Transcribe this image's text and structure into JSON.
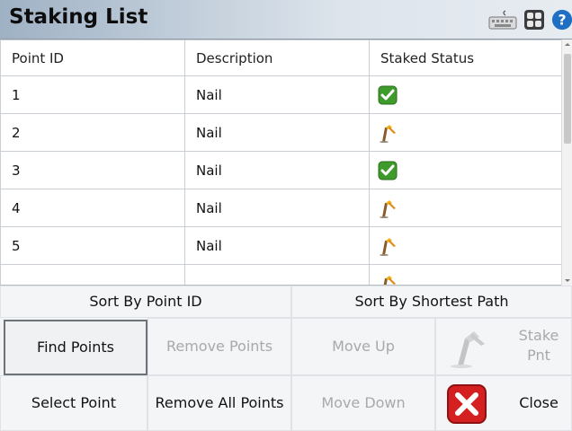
{
  "window": {
    "title": "Staking List"
  },
  "titlebar_icons": [
    "keyboard-icon",
    "grid-icon",
    "help-icon"
  ],
  "table": {
    "columns": [
      "Point ID",
      "Description",
      "Staked Status"
    ],
    "rows": [
      {
        "point_id": "1",
        "description": "Nail",
        "status": "staked"
      },
      {
        "point_id": "2",
        "description": "Nail",
        "status": "not-staked"
      },
      {
        "point_id": "3",
        "description": "Nail",
        "status": "staked"
      },
      {
        "point_id": "4",
        "description": "Nail",
        "status": "not-staked"
      },
      {
        "point_id": "5",
        "description": "Nail",
        "status": "not-staked"
      },
      {
        "point_id": "",
        "description": "",
        "status": "not-staked"
      }
    ]
  },
  "buttons": {
    "sort_by_point_id": "Sort By Point ID",
    "sort_by_shortest_path": "Sort By Shortest Path",
    "find_points": "Find Points",
    "remove_points": "Remove Points",
    "move_up": "Move Up",
    "stake_pnt": "Stake Pnt",
    "select_point": "Select Point",
    "remove_all_points": "Remove All Points",
    "move_down": "Move Down",
    "close": "Close"
  },
  "colors": {
    "staked_check": "#3f9a2c",
    "close_red": "#d42020",
    "help_blue": "#1f6fc3"
  }
}
